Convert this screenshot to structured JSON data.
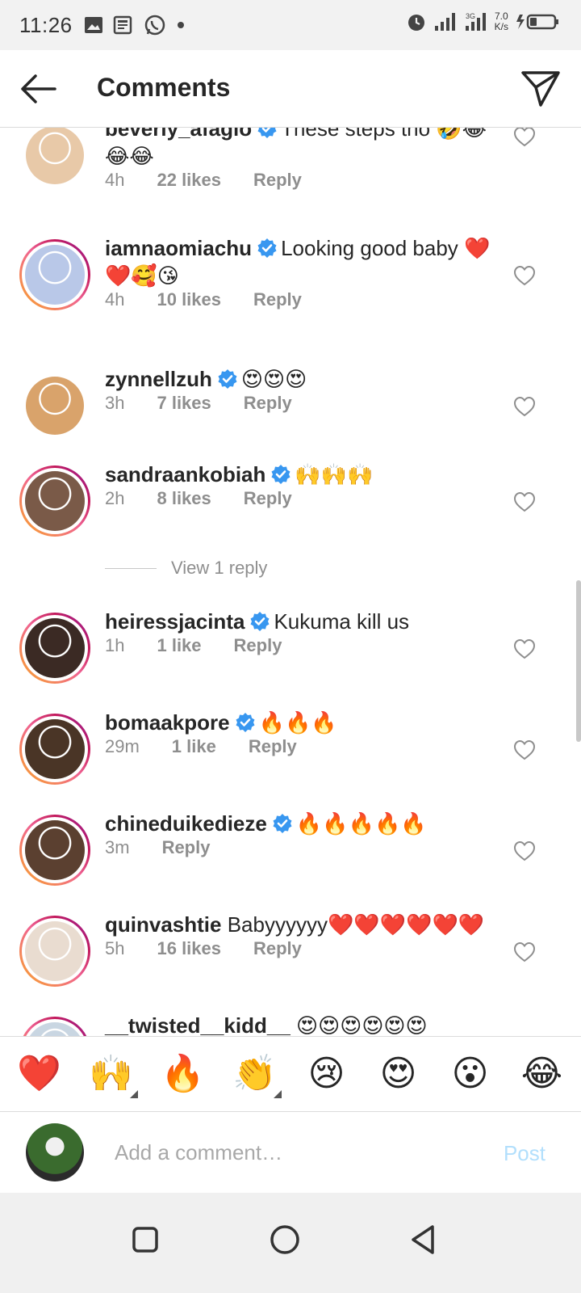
{
  "status_bar": {
    "time": "11:26",
    "network_speed_value": "7.0",
    "network_speed_unit": "K/s",
    "signal_label": "3G",
    "icons": [
      "image-icon",
      "news-icon",
      "whatsapp-icon",
      "dot-icon",
      "alarm-icon",
      "signal-icon",
      "battery-charging-icon"
    ]
  },
  "header": {
    "title": "Comments",
    "back_icon": "back-arrow-icon",
    "send_icon": "direct-send-icon"
  },
  "comments": [
    {
      "username": "beverly_afaglo",
      "text": "These steps tho 🤣😂😂😂",
      "time": "4h",
      "likes": "22 likes",
      "reply": "Reply",
      "verified": true,
      "ring": false,
      "avatar_color": "#e8c9a8"
    },
    {
      "username": "iamnaomiachu",
      "text": "Looking good baby ❤️❤️🥰😘",
      "time": "4h",
      "likes": "10 likes",
      "reply": "Reply",
      "verified": true,
      "ring": true,
      "avatar_color": "#b9c8e8"
    },
    {
      "username": "zynnellzuh",
      "text": "😍😍😍",
      "time": "3h",
      "likes": "7 likes",
      "reply": "Reply",
      "verified": true,
      "ring": false,
      "avatar_color": "#d9a36b"
    },
    {
      "username": "sandraankobiah",
      "text": "🙌🙌🙌",
      "time": "2h",
      "likes": "8 likes",
      "reply": "Reply",
      "verified": true,
      "ring": true,
      "avatar_color": "#7a5a48"
    },
    {
      "username": "heiressjacinta",
      "text": "Kukuma kill us",
      "time": "1h",
      "likes": "1 like",
      "reply": "Reply",
      "verified": true,
      "ring": true,
      "avatar_color": "#3b2a24"
    },
    {
      "username": "bomaakpore",
      "text": "🔥🔥🔥",
      "time": "29m",
      "likes": "1 like",
      "reply": "Reply",
      "verified": true,
      "ring": true,
      "avatar_color": "#4a3526"
    },
    {
      "username": "chineduikedieze",
      "text": "🔥🔥🔥🔥🔥",
      "time": "3m",
      "likes": "",
      "reply": "Reply",
      "verified": true,
      "ring": true,
      "avatar_color": "#5b4030"
    },
    {
      "username": "quinvashtie",
      "text": "Babyyyyyy❤️❤️❤️❤️❤️❤️",
      "time": "5h",
      "likes": "16 likes",
      "reply": "Reply",
      "verified": false,
      "ring": true,
      "avatar_color": "#e9dcd0"
    },
    {
      "username": "__twisted__kidd__",
      "text": "😍😍😍😍😍😍",
      "time": "",
      "likes": "",
      "reply": "",
      "verified": false,
      "ring": true,
      "avatar_color": "#c9d6e2"
    }
  ],
  "view_replies": "View 1 reply",
  "reactions": [
    {
      "emoji": "❤️",
      "more": false
    },
    {
      "emoji": "🙌",
      "more": true
    },
    {
      "emoji": "🔥",
      "more": false
    },
    {
      "emoji": "👏",
      "more": true
    },
    {
      "emoji": "😢",
      "more": false
    },
    {
      "emoji": "😍",
      "more": false
    },
    {
      "emoji": "😮",
      "more": false
    },
    {
      "emoji": "😂",
      "more": false
    }
  ],
  "composer": {
    "placeholder": "Add a comment…",
    "post_label": "Post"
  },
  "navbar": {
    "icons": [
      "recents-square-icon",
      "home-circle-icon",
      "back-triangle-icon"
    ]
  },
  "colors": {
    "verified_blue": "#3897f0",
    "post_disabled": "#b2dffc",
    "meta_gray": "#8e8e8e"
  }
}
